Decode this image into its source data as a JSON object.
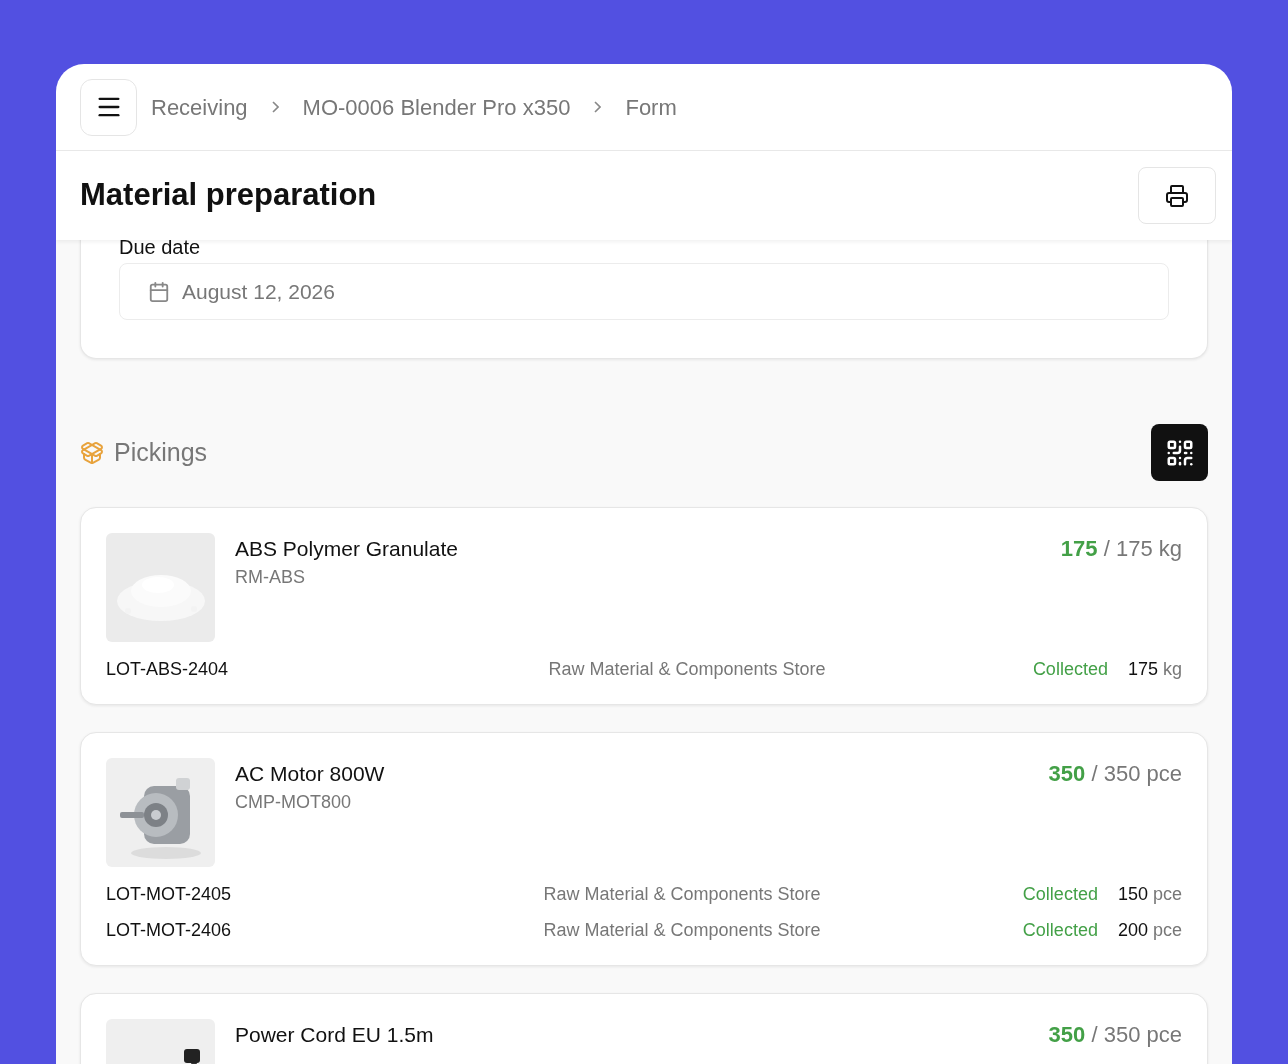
{
  "breadcrumb": [
    "Receiving",
    "MO-0006 Blender Pro x350",
    "Form"
  ],
  "page_title": "Material preparation",
  "form": {
    "due_date": {
      "label": "Due date",
      "value": "August 12, 2026"
    }
  },
  "pickings": {
    "title": "Pickings",
    "items": [
      {
        "name": "ABS Polymer Granulate",
        "code": "RM-ABS",
        "picked": "175",
        "separator": "/",
        "total": "175",
        "unit": "kg",
        "complete": true,
        "lots": [
          {
            "lot": "LOT-ABS-2404",
            "location": "Raw Material & Components Store",
            "status": "Collected",
            "qty": "175",
            "unit": "kg"
          }
        ]
      },
      {
        "name": "AC Motor 800W",
        "code": "CMP-MOT800",
        "picked": "350",
        "separator": "/",
        "total": "350",
        "unit": "pce",
        "complete": true,
        "lots": [
          {
            "lot": "LOT-MOT-2405",
            "location": "Raw Material & Components Store",
            "status": "Collected",
            "qty": "150",
            "unit": "pce"
          },
          {
            "lot": "LOT-MOT-2406",
            "location": "Raw Material & Components Store",
            "status": "Collected",
            "qty": "200",
            "unit": "pce"
          }
        ]
      },
      {
        "name": "Power Cord EU 1.5m",
        "picked": "350",
        "separator": "/",
        "total": "350",
        "unit": "pce",
        "complete": true
      }
    ]
  }
}
